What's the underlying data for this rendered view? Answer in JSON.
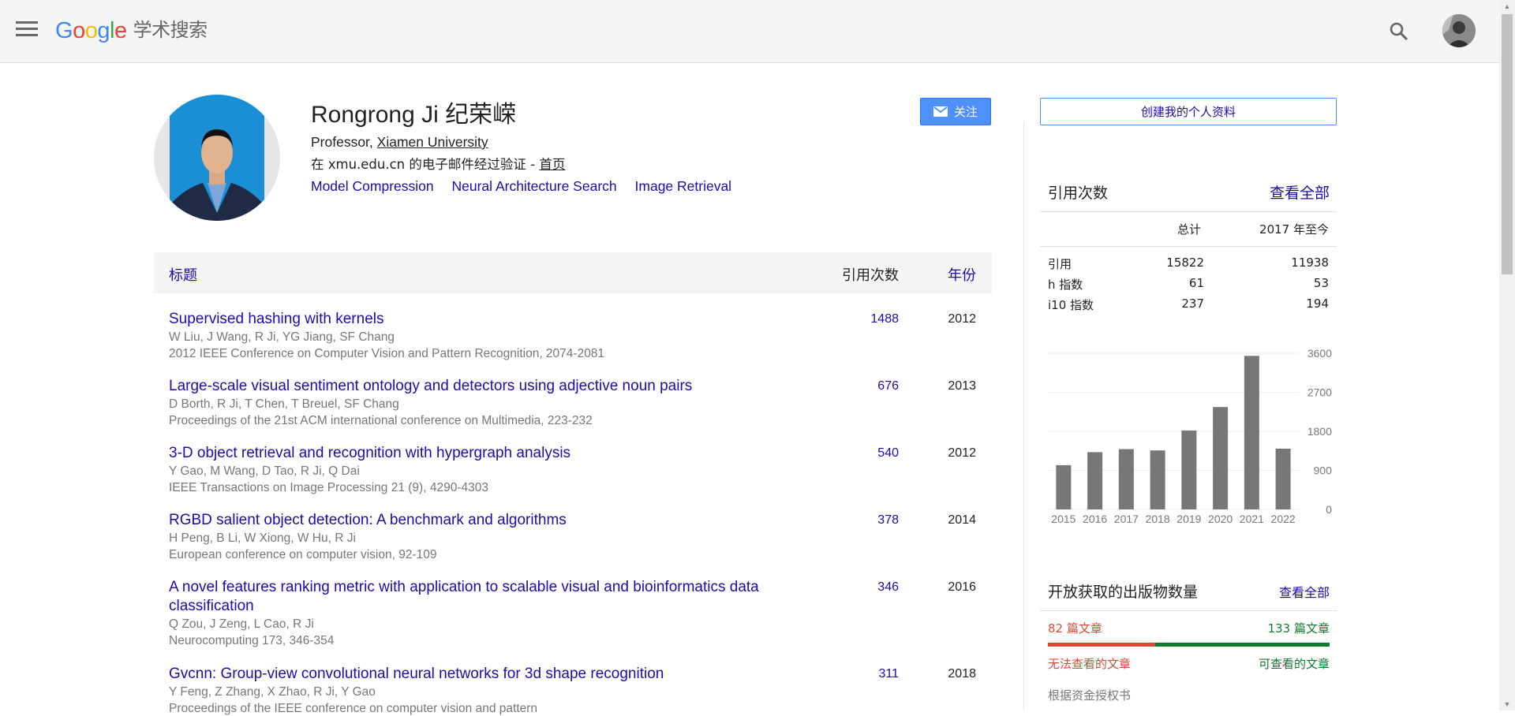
{
  "header": {
    "logo_word": "Google",
    "logo_sub": "学术搜索",
    "logo_colors": [
      "#4285f4",
      "#ea4335",
      "#fbbc05",
      "#4285f4",
      "#34a853",
      "#ea4335"
    ]
  },
  "profile": {
    "name": "Rongrong Ji 纪荣嵘",
    "title_prefix": "Professor, ",
    "affiliation": "Xiamen University",
    "email_text": "在 xmu.edu.cn 的电子邮件经过验证 - ",
    "homepage_label": "首页",
    "interests": [
      "Model Compression",
      "Neural Architecture Search",
      "Image Retrieval"
    ],
    "follow_label": "关注"
  },
  "table": {
    "col_title": "标题",
    "col_cites": "引用次数",
    "col_year": "年份",
    "rows": [
      {
        "title": "Supervised hashing with kernels",
        "authors": "W Liu, J Wang, R Ji, YG Jiang, SF Chang",
        "venue": "2012 IEEE Conference on Computer Vision and Pattern Recognition, 2074-2081",
        "cites": "1488",
        "year": "2012"
      },
      {
        "title": "Large-scale visual sentiment ontology and detectors using adjective noun pairs",
        "authors": "D Borth, R Ji, T Chen, T Breuel, SF Chang",
        "venue": "Proceedings of the 21st ACM international conference on Multimedia, 223-232",
        "cites": "676",
        "year": "2013"
      },
      {
        "title": "3-D object retrieval and recognition with hypergraph analysis",
        "authors": "Y Gao, M Wang, D Tao, R Ji, Q Dai",
        "venue": "IEEE Transactions on Image Processing 21 (9), 4290-4303",
        "cites": "540",
        "year": "2012"
      },
      {
        "title": "RGBD salient object detection: A benchmark and algorithms",
        "authors": "H Peng, B Li, W Xiong, W Hu, R Ji",
        "venue": "European conference on computer vision, 92-109",
        "cites": "378",
        "year": "2014"
      },
      {
        "title": "A novel features ranking metric with application to scalable visual and bioinformatics data classification",
        "authors": "Q Zou, J Zeng, L Cao, R Ji",
        "venue": "Neurocomputing 173, 346-354",
        "cites": "346",
        "year": "2016"
      },
      {
        "title": "Gvcnn: Group-view convolutional neural networks for 3d shape recognition",
        "authors": "Y Feng, Z Zhang, X Zhao, R Ji, Y Gao",
        "venue": "Proceedings of the IEEE conference on computer vision and pattern",
        "cites": "311",
        "year": "2018"
      }
    ]
  },
  "sidebar": {
    "create_profile_label": "创建我的个人资料",
    "cited_by": {
      "title": "引用次数",
      "view_all": "查看全部",
      "col_all": "总计",
      "col_since": "2017 年至今",
      "rows": [
        {
          "label": "引用",
          "all": "15822",
          "since": "11938"
        },
        {
          "label": "h 指数",
          "all": "61",
          "since": "53"
        },
        {
          "label": "i10 指数",
          "all": "237",
          "since": "194"
        }
      ]
    },
    "open_access": {
      "title": "开放获取的出版物数量",
      "view_all": "查看全部",
      "unavailable_count": "82 篇文章",
      "available_count": "133 篇文章",
      "unavailable_label": "无法查看的文章",
      "available_label": "可查看的文章",
      "unavailable_fraction": 0.381,
      "mandate_label": "根据资金授权书",
      "unavailable_color": "#d84a38",
      "available_color": "#0f7b30"
    }
  },
  "chart_data": {
    "type": "bar",
    "categories": [
      "2015",
      "2016",
      "2017",
      "2018",
      "2019",
      "2020",
      "2021",
      "2022"
    ],
    "values": [
      1020,
      1320,
      1390,
      1360,
      1820,
      2360,
      3540,
      1400
    ],
    "ylim": [
      0,
      3600
    ],
    "yticks": [
      "0",
      "900",
      "1800",
      "2700",
      "3600"
    ],
    "grid": true,
    "bar_color": "#777777"
  }
}
